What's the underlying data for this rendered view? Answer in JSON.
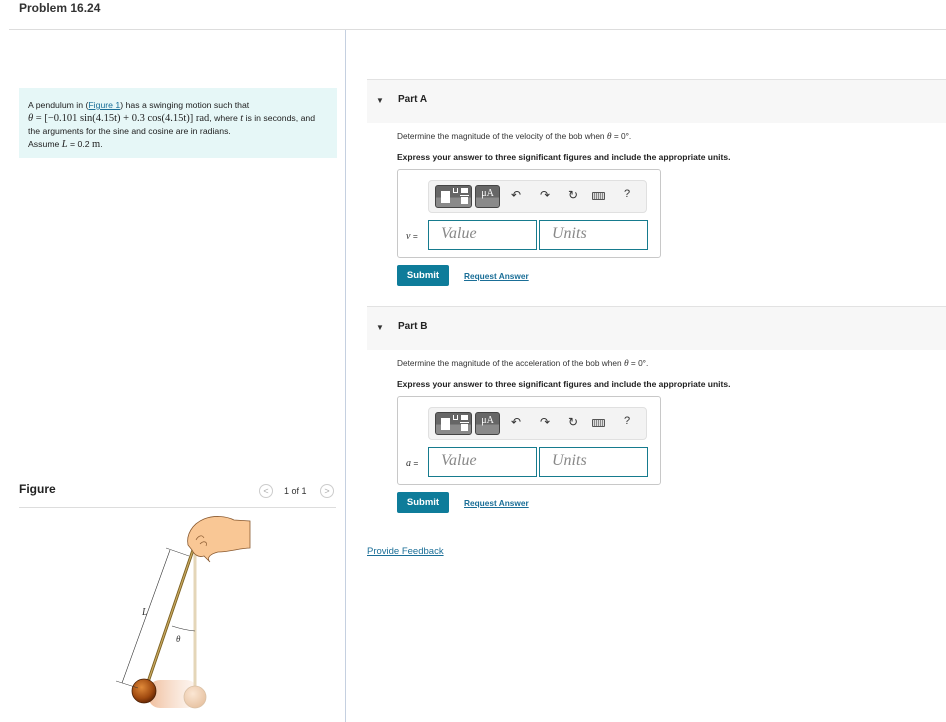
{
  "problem": {
    "title": "Problem 16.24"
  },
  "intro": {
    "text_before_link": "A pendulum in (",
    "link": "Figure 1",
    "text_after_link": ") has a swinging motion such that",
    "eq_lhs": "θ",
    "eq_body": " = [−0.101 sin(4.15t) + 0.3 cos(4.15t)] rad",
    "text_where": ", where ",
    "var_t": "t",
    "text_rest": " is in seconds, and the arguments for the sine and cosine are in radians.",
    "assume_prefix": "Assume ",
    "assume_var": "L",
    "assume_value": " = 0.2 ",
    "assume_unit": "m",
    "assume_suffix": "."
  },
  "figure": {
    "label": "Figure",
    "pager": {
      "prev_icon": "chevron-left-icon",
      "next_icon": "chevron-right-icon",
      "prev_glyph": "<",
      "next_glyph": ">",
      "count": "1 of 1"
    },
    "labels": {
      "length": "L",
      "angle": "θ"
    }
  },
  "parts": [
    {
      "title": "Part A",
      "question_prefix": "Determine the magnitude of the velocity of the bob when ",
      "question_var": "θ",
      "question_suffix": " = 0°.",
      "instructions": "Express your answer to three significant figures and include the appropriate units.",
      "variable": "v",
      "equals": "=",
      "value_placeholder": "Value",
      "units_placeholder": "Units",
      "toolbar": {
        "templates_icon": "templates-icon",
        "units_label": "μA",
        "undo": "↶",
        "redo": "↷",
        "reset": "↻",
        "keyboard_icon": "keyboard-icon",
        "help": "?"
      },
      "submit": "Submit",
      "request": "Request Answer"
    },
    {
      "title": "Part B",
      "question_prefix": "Determine the magnitude of the acceleration of the bob when ",
      "question_var": "θ",
      "question_suffix": " = 0°.",
      "instructions": "Express your answer to three significant figures and include the appropriate units.",
      "variable": "a",
      "equals": "=",
      "value_placeholder": "Value",
      "units_placeholder": "Units",
      "toolbar": {
        "templates_icon": "templates-icon",
        "units_label": "μA",
        "undo": "↶",
        "redo": "↷",
        "reset": "↻",
        "keyboard_icon": "keyboard-icon",
        "help": "?"
      },
      "submit": "Submit",
      "request": "Request Answer"
    }
  ],
  "feedback": "Provide Feedback",
  "colors": {
    "accent": "#0e7c9a",
    "link": "#1a6e97",
    "intro_bg": "#e6f7f7"
  }
}
